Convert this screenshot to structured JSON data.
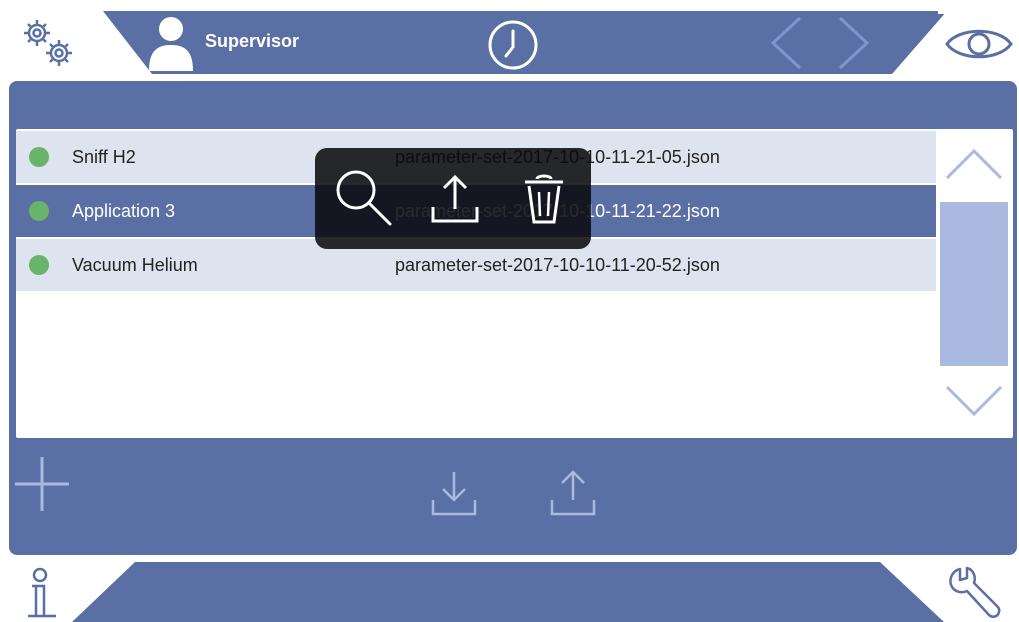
{
  "header": {
    "user_name": "Supervisor"
  },
  "icons": {
    "settings": "gears-icon",
    "user": "user-avatar-icon",
    "clock": "clock-icon",
    "back": "chevron-left-icon",
    "forward": "chevron-right-icon",
    "view": "eye-icon",
    "scroll_up": "chevron-up-icon",
    "scroll_down": "chevron-down-icon",
    "add": "plus-icon",
    "import": "download-icon",
    "export": "upload-icon",
    "popup_view": "magnifier-icon",
    "popup_export": "upload-icon",
    "popup_delete": "trash-icon",
    "info": "info-icon",
    "service": "wrench-icon"
  },
  "list": {
    "rows": [
      {
        "name": "Sniff H2",
        "file": "parameter-set-2017-10-10-11-21-05.json",
        "status_color": "#69b36b"
      },
      {
        "name": "Application 3",
        "file": "parameter-set-2017-10-10-11-21-22.json",
        "status_color": "#69b36b",
        "selected": true
      },
      {
        "name": "Vacuum Helium",
        "file": "parameter-set-2017-10-10-11-20-52.json",
        "status_color": "#69b36b"
      }
    ]
  },
  "colors": {
    "panel": "#5a6fa3",
    "row_alt": "#dde3ef",
    "row_selected": "#5a6fa3",
    "scroll_thumb": "#a9b9e0",
    "status_ok": "#69b36b"
  }
}
